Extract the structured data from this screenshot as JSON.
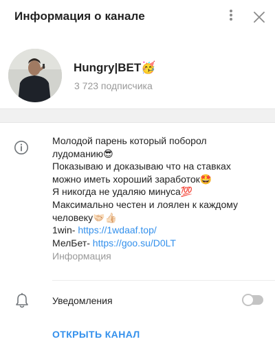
{
  "header": {
    "title": "Информация о канале",
    "menu_icon": "more-vertical-icon",
    "close_icon": "close-icon"
  },
  "channel": {
    "name": "Hungry|BET🥳",
    "subscribers": "3 723 подписчика"
  },
  "about": {
    "lines": [
      "Молодой парень который поборол",
      "лудоманию😎",
      "Показываю и доказываю что на ставках",
      "можно иметь хороший заработок🤩",
      "Я никогда не удаляю минуса💯",
      "Максимально честен и лоялен к каждому",
      "человеку🤝🏻👍🏻"
    ],
    "links": [
      {
        "prefix": "1win- ",
        "url": "https://1wdaaf.top/"
      },
      {
        "prefix": "МелБет- ",
        "url": "https://goo.su/D0LT"
      }
    ],
    "caption": "Информация"
  },
  "notifications": {
    "label": "Уведомления",
    "enabled": false
  },
  "actions": {
    "open_channel": "ОТКРЫТЬ КАНАЛ"
  },
  "colors": {
    "accent": "#3390ec",
    "muted": "#999999",
    "band": "#f1f1f1"
  }
}
